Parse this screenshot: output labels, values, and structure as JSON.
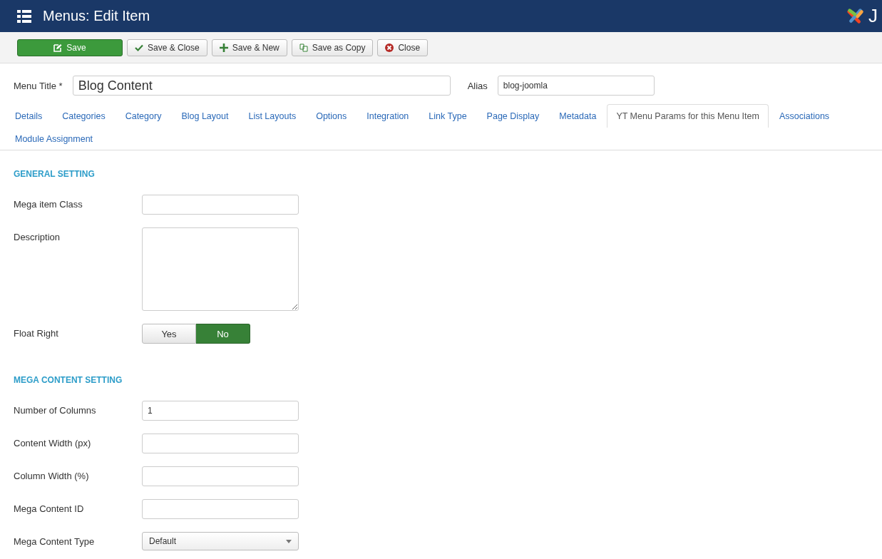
{
  "header": {
    "title": "Menus: Edit Item",
    "logo_text": "J"
  },
  "toolbar": [
    {
      "label": "Save",
      "kind": "save"
    },
    {
      "label": "Save & Close",
      "kind": "check"
    },
    {
      "label": "Save & New",
      "kind": "plus"
    },
    {
      "label": "Save as Copy",
      "kind": "copy"
    },
    {
      "label": "Close",
      "kind": "close"
    }
  ],
  "title_field": {
    "label": "Menu Title *",
    "value": "Blog Content"
  },
  "alias_field": {
    "label": "Alias",
    "value": "blog-joomla"
  },
  "tabs": [
    {
      "label": "Details",
      "selected": false
    },
    {
      "label": "Categories",
      "selected": false
    },
    {
      "label": "Category",
      "selected": false
    },
    {
      "label": "Blog Layout",
      "selected": false
    },
    {
      "label": "List Layouts",
      "selected": false
    },
    {
      "label": "Options",
      "selected": false
    },
    {
      "label": "Integration",
      "selected": false
    },
    {
      "label": "Link Type",
      "selected": false
    },
    {
      "label": "Page Display",
      "selected": false
    },
    {
      "label": "Metadata",
      "selected": false
    },
    {
      "label": "YT Menu Params for this Menu Item",
      "selected": true
    },
    {
      "label": "Associations",
      "selected": false
    },
    {
      "label": "Module Assignment",
      "selected": false
    }
  ],
  "sections": [
    {
      "title": "GENERAL SETTING",
      "fields": [
        {
          "label": "Mega item Class",
          "kind": "text"
        },
        {
          "label": "Description",
          "kind": "textarea"
        },
        {
          "label": "Float Right",
          "kind": "toggle",
          "options": [
            {
              "label": "Yes",
              "selected": false
            },
            {
              "label": "No",
              "selected": true
            }
          ]
        }
      ]
    },
    {
      "title": "MEGA CONTENT SETTING",
      "fields": [
        {
          "label": "Number of Columns",
          "kind": "text",
          "value": "1"
        },
        {
          "label": "Content Width (px)",
          "kind": "text"
        },
        {
          "label": "Column Width (%)",
          "kind": "text"
        },
        {
          "label": "Mega Content ID",
          "kind": "text"
        },
        {
          "label": "Mega Content Type",
          "kind": "select",
          "value": "Default"
        }
      ]
    }
  ]
}
